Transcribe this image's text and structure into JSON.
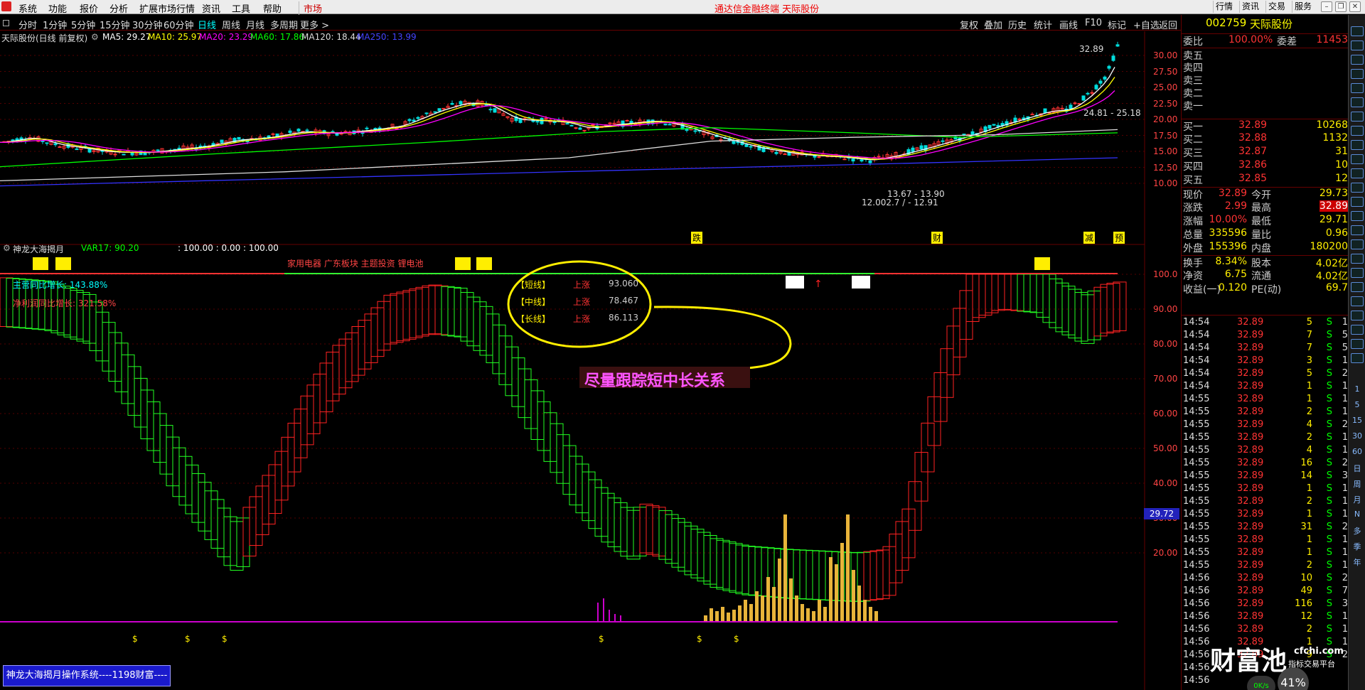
{
  "menu": {
    "items": [
      "系统",
      "功能",
      "报价",
      "分析",
      "扩展市场行情",
      "资讯",
      "工具",
      "帮助"
    ],
    "market_tab": "市场",
    "app_title": "通达信金融终端  天际股份",
    "right_buttons": [
      "行情",
      "资讯",
      "交易",
      "服务"
    ]
  },
  "periods": {
    "items": [
      "分时",
      "1分钟",
      "5分钟",
      "15分钟",
      "30分钟",
      "60分钟",
      "日线",
      "周线",
      "月线",
      "多周期",
      "更多 >"
    ],
    "active": "日线"
  },
  "toolbar": {
    "items": [
      "复权",
      "叠加",
      "历史",
      "统计",
      "画线",
      "F10",
      "标记",
      "+自选",
      "返回"
    ]
  },
  "main_chart": {
    "stock_label": "天际股份(日线 前复权)",
    "ma_items": [
      {
        "label": "MA5: 29.27",
        "color": "#ffffff"
      },
      {
        "label": "MA10: 25.97",
        "color": "#ffff00"
      },
      {
        "label": "MA20: 23.29",
        "color": "#ff00ff"
      },
      {
        "label": "MA60: 17.86",
        "color": "#00ff00"
      },
      {
        "label": "MA120: 18.44",
        "color": "#dddddd"
      },
      {
        "label": "MA250: 13.99",
        "color": "#3333ff"
      }
    ],
    "y_ticks": [
      "30.00",
      "27.50",
      "25.00",
      "22.50",
      "20.00",
      "17.50",
      "15.00",
      "12.50",
      "10.00"
    ],
    "annotations": {
      "high": "32.89",
      "right_range": "24.81 - 25.18",
      "low_range1": "13.67 - 13.90",
      "low_range2": "12.002.7 / - 12.91"
    },
    "event_markers": [
      "跌",
      "财",
      "减",
      "预"
    ]
  },
  "indicator": {
    "name": "神龙大海揭月",
    "var17": "VAR17: 90.20",
    "values": ": 100.00 : 0.00 : 100.00",
    "sectors": "家用电器 广东板块 主题投资 锂电池",
    "main_growth": "主营同比增长: 143.88%",
    "profit_growth": "净利润同比增长: 321.58%",
    "legend": [
      {
        "name": "【短线】",
        "trend": "上涨",
        "value": "93.060"
      },
      {
        "name": "【中线】",
        "trend": "上涨",
        "value": "78.467"
      },
      {
        "name": "【长线】",
        "trend": "上涨",
        "value": "86.113"
      }
    ],
    "callout": "尽量跟踪短中长关系",
    "y_ticks": [
      "100.0",
      "90.00",
      "80.00",
      "70.00",
      "60.00",
      "50.00",
      "40.00",
      "30.00",
      "20.00"
    ],
    "cursor_value": "29.72",
    "dollar_marker": "$"
  },
  "bottom": {
    "button": "神龙大海揭月操作系统----1198财富----"
  },
  "quote": {
    "code": "002759",
    "name": "天际股份",
    "weibi_label": "委比",
    "weibi": "100.00%",
    "weicha_label": "委差",
    "weicha": "11453",
    "sells": [
      "卖五",
      "卖四",
      "卖三",
      "卖二",
      "卖一"
    ],
    "buys": [
      {
        "label": "买一",
        "price": "32.89",
        "vol": "10268"
      },
      {
        "label": "买二",
        "price": "32.88",
        "vol": "1132"
      },
      {
        "label": "买三",
        "price": "32.87",
        "vol": "31"
      },
      {
        "label": "买四",
        "price": "32.86",
        "vol": "10"
      },
      {
        "label": "买五",
        "price": "32.85",
        "vol": "12"
      }
    ],
    "stats": [
      [
        "现价",
        "32.89",
        "今开",
        "29.73"
      ],
      [
        "涨跌",
        "2.99",
        "最高",
        "32.89"
      ],
      [
        "涨幅",
        "10.00%",
        "最低",
        "29.71"
      ],
      [
        "总量",
        "335596",
        "量比",
        "0.96"
      ],
      [
        "外盘",
        "155396",
        "内盘",
        "180200"
      ]
    ],
    "stats2": [
      [
        "换手",
        "8.34%",
        "股本",
        "4.02亿"
      ],
      [
        "净资",
        "6.75",
        "流通",
        "4.02亿"
      ],
      [
        "收益(一)",
        "0.120",
        "PE(动)",
        "69.7"
      ]
    ],
    "ticks": [
      [
        "14:54",
        "32.89",
        "5",
        "S",
        "1"
      ],
      [
        "14:54",
        "32.89",
        "7",
        "S",
        "5"
      ],
      [
        "14:54",
        "32.89",
        "7",
        "S",
        "5"
      ],
      [
        "14:54",
        "32.89",
        "3",
        "S",
        "1"
      ],
      [
        "14:54",
        "32.89",
        "5",
        "S",
        "2"
      ],
      [
        "14:54",
        "32.89",
        "1",
        "S",
        "1"
      ],
      [
        "14:55",
        "32.89",
        "1",
        "S",
        "1"
      ],
      [
        "14:55",
        "32.89",
        "2",
        "S",
        "1"
      ],
      [
        "14:55",
        "32.89",
        "4",
        "S",
        "2"
      ],
      [
        "14:55",
        "32.89",
        "2",
        "S",
        "1"
      ],
      [
        "14:55",
        "32.89",
        "4",
        "S",
        "1"
      ],
      [
        "14:55",
        "32.89",
        "16",
        "S",
        "2"
      ],
      [
        "14:55",
        "32.89",
        "14",
        "S",
        "3"
      ],
      [
        "14:55",
        "32.89",
        "1",
        "S",
        "1"
      ],
      [
        "14:55",
        "32.89",
        "2",
        "S",
        "1"
      ],
      [
        "14:55",
        "32.89",
        "1",
        "S",
        "1"
      ],
      [
        "14:55",
        "32.89",
        "31",
        "S",
        "2"
      ],
      [
        "14:55",
        "32.89",
        "1",
        "S",
        "1"
      ],
      [
        "14:55",
        "32.89",
        "1",
        "S",
        "1"
      ],
      [
        "14:55",
        "32.89",
        "2",
        "S",
        "1"
      ],
      [
        "14:56",
        "32.89",
        "10",
        "S",
        "2"
      ],
      [
        "14:56",
        "32.89",
        "49",
        "S",
        "7"
      ],
      [
        "14:56",
        "32.89",
        "116",
        "S",
        "3"
      ],
      [
        "14:56",
        "32.89",
        "12",
        "S",
        "1"
      ],
      [
        "14:56",
        "32.89",
        "2",
        "S",
        "1"
      ],
      [
        "14:56",
        "32.89",
        "1",
        "S",
        "1"
      ],
      [
        "14:56",
        "32.89",
        "9",
        "S",
        "2"
      ],
      [
        "14:56",
        "",
        "",
        " ",
        ""
      ],
      [
        "14:56",
        "",
        "",
        " ",
        ""
      ]
    ],
    "watermark_cn": "财富池",
    "watermark_en": "cfchi.com",
    "watermark_sub": "指标交易平台",
    "net_speed": "0K/s",
    "cpu": "41%"
  },
  "sidebar": [
    "1",
    "5",
    "15",
    "30",
    "60",
    "日",
    "周",
    "月",
    "N",
    "多",
    "季",
    "年"
  ]
}
